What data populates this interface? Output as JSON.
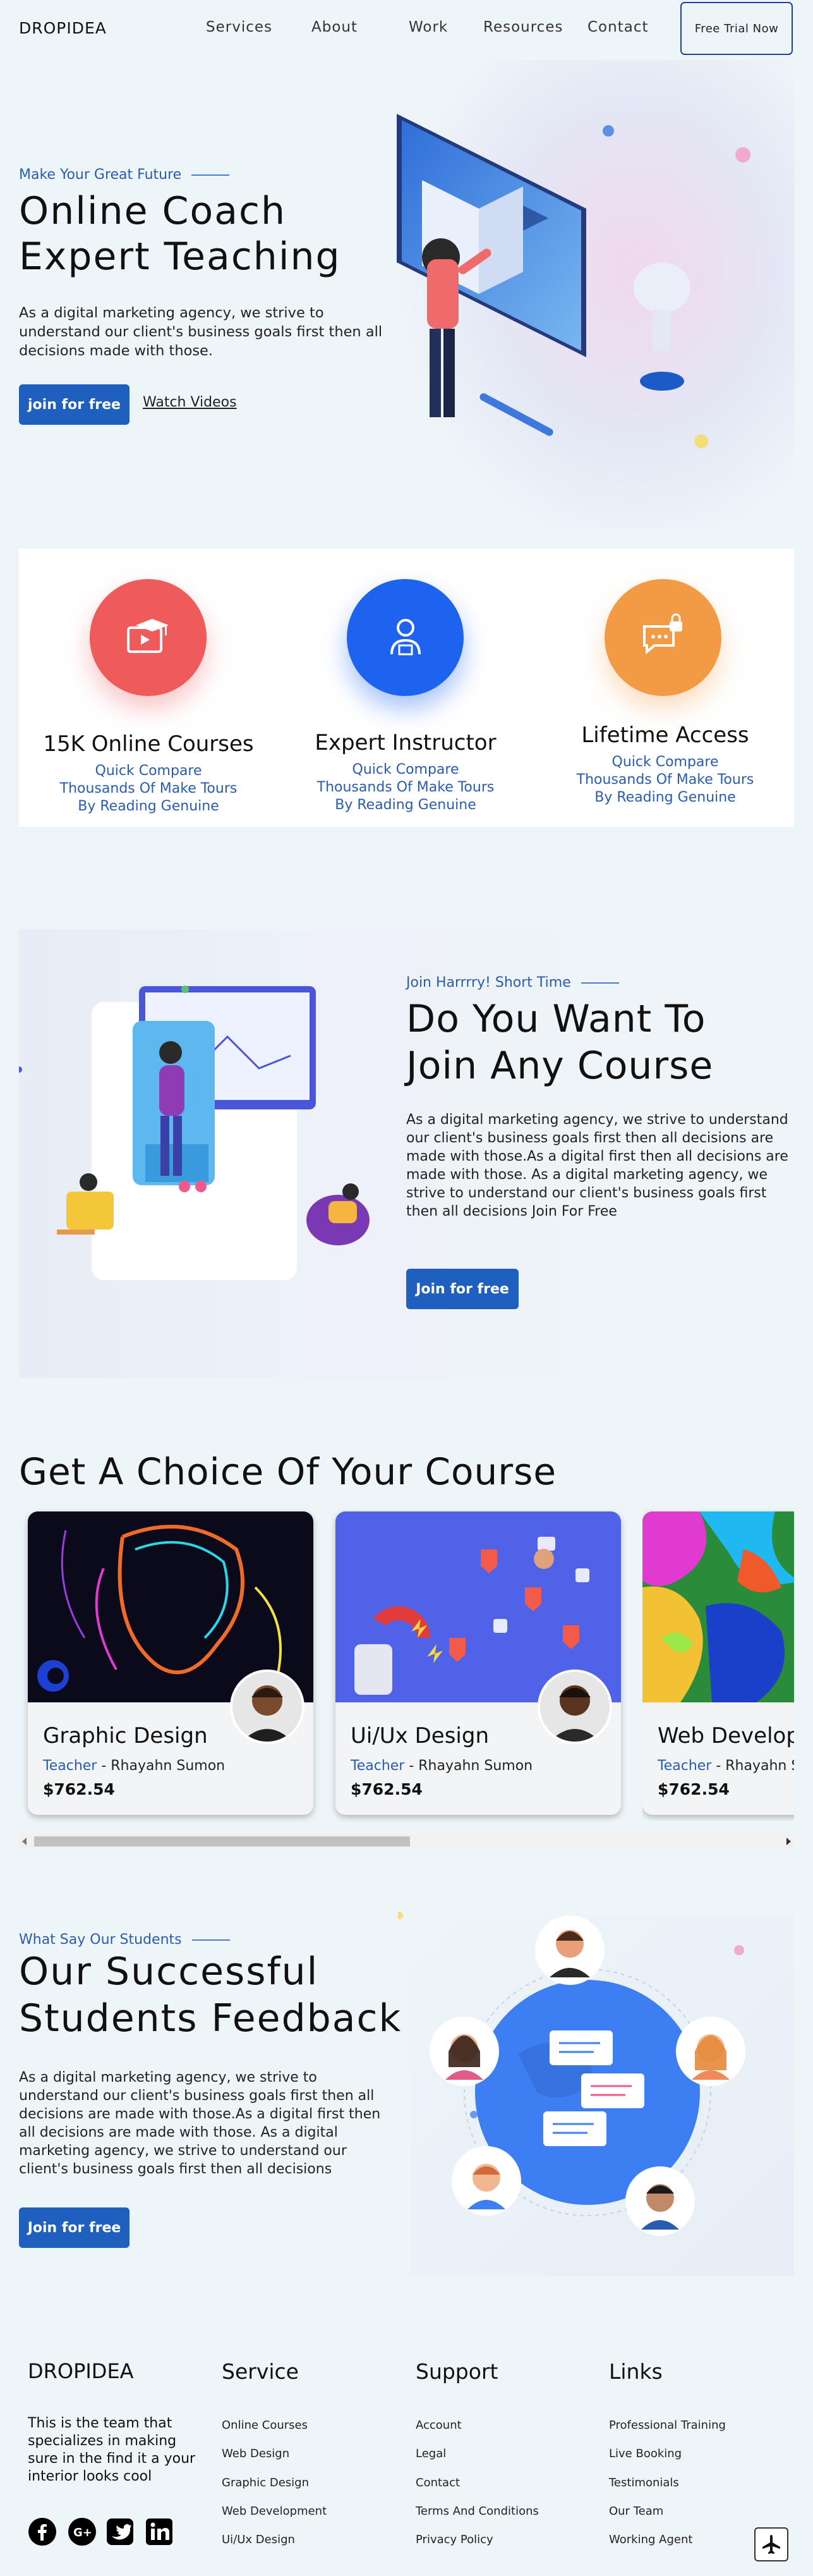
{
  "nav": {
    "logo": "DROPIDEA",
    "items": [
      "Services",
      "About",
      "Work",
      "Resources",
      "Contact"
    ],
    "cta": "Free Trial Now"
  },
  "hero": {
    "eyebrow": "Make Your Great Future",
    "title_line1": "Online Coach",
    "title_line2": "Expert Teaching",
    "body": "As a digital marketing agency, we strive to understand our client's business goals first then all decisions made with those.",
    "primary_btn": "join for free",
    "secondary_link": "Watch Videos"
  },
  "features": [
    {
      "icon": "video-course-icon",
      "title": "15K Online Courses",
      "lines": [
        "Quick Compare",
        "Thousands Of Make Tours",
        "By Reading Genuine"
      ],
      "color": "#ef5a5a"
    },
    {
      "icon": "instructor-icon",
      "title": "Expert Instructor",
      "lines": [
        "Quick Compare",
        "Thousands Of Make Tours",
        "By Reading Genuine"
      ],
      "color": "#1e63f0"
    },
    {
      "icon": "secure-chat-icon",
      "title": "Lifetime Access",
      "lines": [
        "Quick Compare",
        "Thousands Of Make Tours",
        "By Reading Genuine"
      ],
      "color": "#f39a45"
    }
  ],
  "join": {
    "eyebrow": "Join Harrrry! Short Time",
    "title_line1": "Do You Want To",
    "title_line2": "Join Any Course",
    "body": "As a digital marketing agency, we strive to understand our client's business goals first then all decisions are made with those.As a digital first then all decisions are made with those. As a digital marketing agency, we strive to understand our client's business goals first then all decisions Join For Free",
    "btn": "Join for free"
  },
  "courses": {
    "heading": "Get A Choice Of Your Course",
    "cards": [
      {
        "title": "Graphic Design",
        "role": "Teacher",
        "teacher": " - Rhayahn Sumon",
        "price": "$762.54"
      },
      {
        "title": "Ui/Ux Design",
        "role": "Teacher",
        "teacher": " - Rhayahn Sumon",
        "price": "$762.54"
      },
      {
        "title": "Web Development",
        "role": "Teacher",
        "teacher": " - Rhayahn Sumon",
        "price": "$762.54"
      }
    ]
  },
  "feedback": {
    "eyebrow": "What Say Our Students",
    "title_line1": "Our Successful",
    "title_line2": "Students Feedback",
    "body": "As a digital marketing agency, we strive to understand our client's business goals first then all decisions are made with those.As a digital first then all decisions are made with those. As a digital marketing agency, we strive to understand our client's business goals first then all decisions",
    "btn": "Join for free"
  },
  "footer": {
    "brand": "DROPIDEA",
    "about": "This is the team that specializes in making sure in the find it a your interior looks cool",
    "service_heading": "Service",
    "service_links": [
      "Online Courses",
      "Web Design",
      "Graphic Design",
      "Web Development",
      "Ui/Ux Design"
    ],
    "support_heading": "Support",
    "support_links": [
      "Account",
      "Legal",
      "Contact",
      "Terms And Conditions",
      "Privacy Policy"
    ],
    "links_heading": "Links",
    "links_links": [
      "Professional Training",
      "Live Booking",
      "Testimonials",
      "Our Team",
      "Working Agent"
    ],
    "social": [
      "facebook-icon",
      "google-plus-icon",
      "twitter-icon",
      "linkedin-icon"
    ]
  }
}
